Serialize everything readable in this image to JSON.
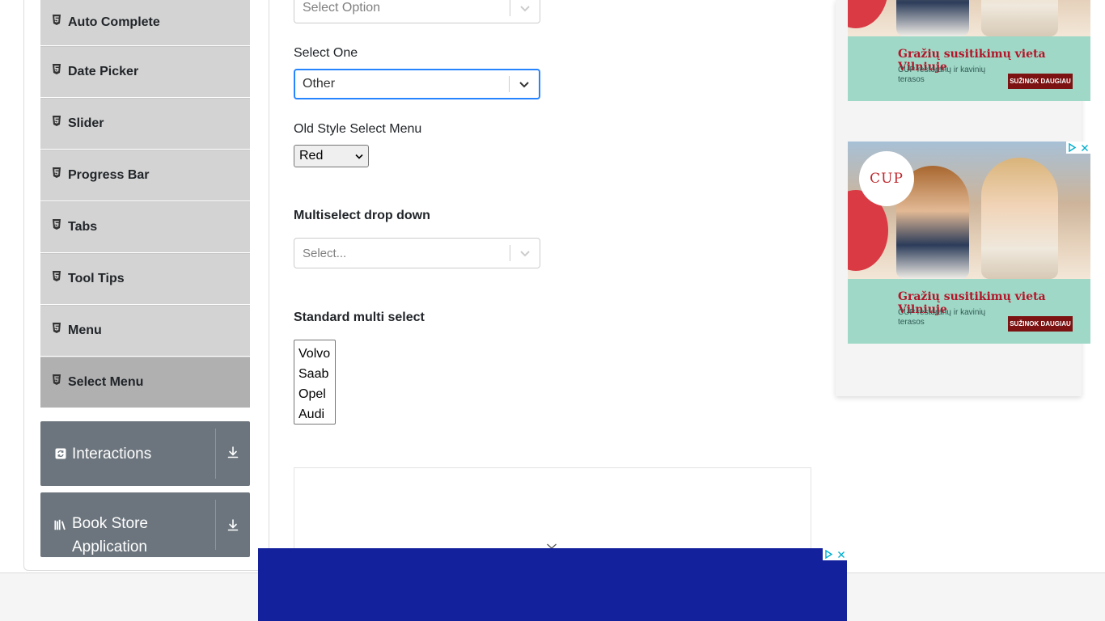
{
  "sidebar": {
    "items": [
      {
        "label": "Auto Complete"
      },
      {
        "label": "Date Picker"
      },
      {
        "label": "Slider"
      },
      {
        "label": "Progress Bar"
      },
      {
        "label": "Tabs"
      },
      {
        "label": "Tool Tips"
      },
      {
        "label": "Menu"
      },
      {
        "label": "Select Menu",
        "active": true
      }
    ],
    "groups": [
      {
        "label": "Interactions",
        "icon": "interactions-icon"
      },
      {
        "label": "Book Store Application",
        "icon": "book-store-icon"
      }
    ]
  },
  "form": {
    "select_value": {
      "placeholder": "Select Option"
    },
    "select_one": {
      "label": "Select One",
      "value": "Other"
    },
    "old_style": {
      "label": "Old Style Select Menu",
      "value": "Red"
    },
    "multiselect": {
      "label": "Multiselect drop down",
      "placeholder": "Select..."
    },
    "standard_multi": {
      "label": "Standard multi select",
      "options": [
        "Volvo",
        "Saab",
        "Opel",
        "Audi"
      ]
    }
  },
  "ads": {
    "banner": {
      "headline": "Gražių susitikimų vieta Vilniuje",
      "sub": "CUP restoranų ir kavinių terasos",
      "cta": "SUŽINOK DAUGIAU",
      "logo": "CUP"
    }
  },
  "colors": {
    "focus_border": "#2684ff",
    "sidebar_item": "#d3d3d3",
    "group_header": "#6c757d",
    "bottom_ad": "#13219c",
    "ad_green": "#9fd8c6",
    "ad_cta": "#7c1212"
  }
}
